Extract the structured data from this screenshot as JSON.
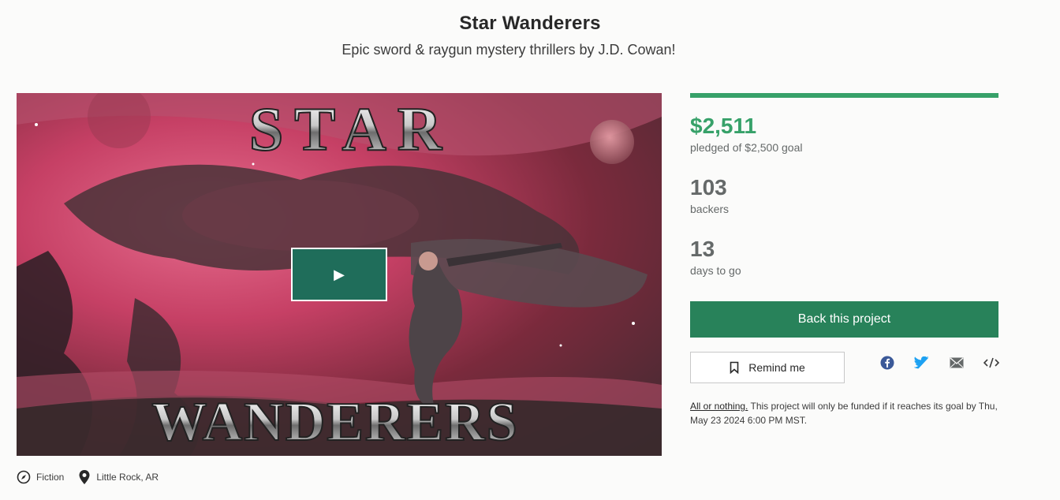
{
  "project": {
    "title": "Star Wanderers",
    "subtitle": "Epic sword & raygun mystery thrillers by J.D. Cowan!"
  },
  "video": {
    "cover_title_top": "STAR",
    "cover_title_bottom": "WANDERERS",
    "play_icon": "▶"
  },
  "meta": {
    "category": "Fiction",
    "location": "Little Rock, AR"
  },
  "funding": {
    "pledged": "$2,511",
    "pledged_label": "pledged of $2,500 goal",
    "progress_fraction": 1.0,
    "backers": "103",
    "backers_label": "backers",
    "days": "13",
    "days_label": "days to go"
  },
  "actions": {
    "back_label": "Back this project",
    "remind_label": "Remind me"
  },
  "share_icons": [
    "facebook-icon",
    "twitter-icon",
    "email-icon",
    "embed-icon"
  ],
  "fine_print": {
    "link": "All or nothing.",
    "text": " This project will only be funded if it reaches its goal by Thu, May 23 2024 6:00 PM MST."
  },
  "colors": {
    "accent_green": "#37a169",
    "button_green": "#28825a",
    "play_button": "#1f6d5a",
    "facebook": "#3b5998",
    "twitter": "#1da1f2"
  }
}
